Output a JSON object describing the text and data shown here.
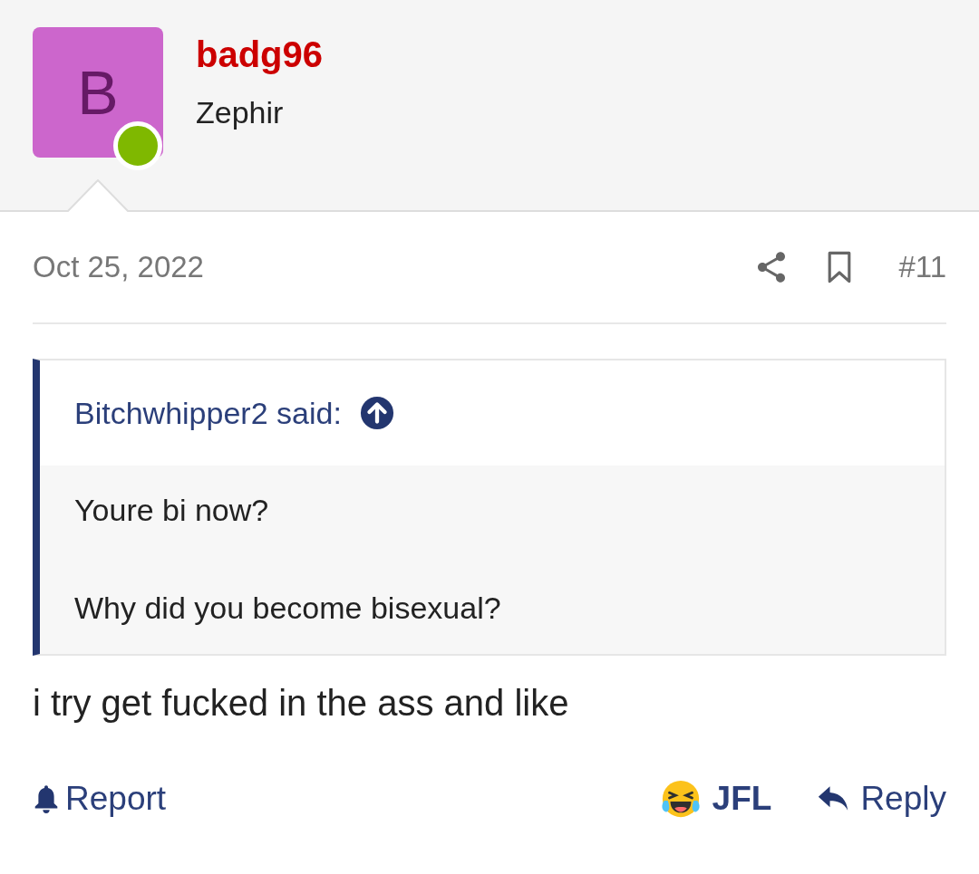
{
  "user": {
    "avatar_letter": "B",
    "online": true,
    "name": "badg96",
    "title": "Zephir"
  },
  "post": {
    "date": "Oct 25, 2022",
    "number": "#11",
    "quote": {
      "author": "Bitchwhipper2 said:",
      "lines": [
        "Youre bi now?",
        "Why did you become bisexual?"
      ]
    },
    "body": "i try get fucked in the ass and like"
  },
  "actions": {
    "report": "Report",
    "reaction": "JFL",
    "reply": "Reply"
  }
}
